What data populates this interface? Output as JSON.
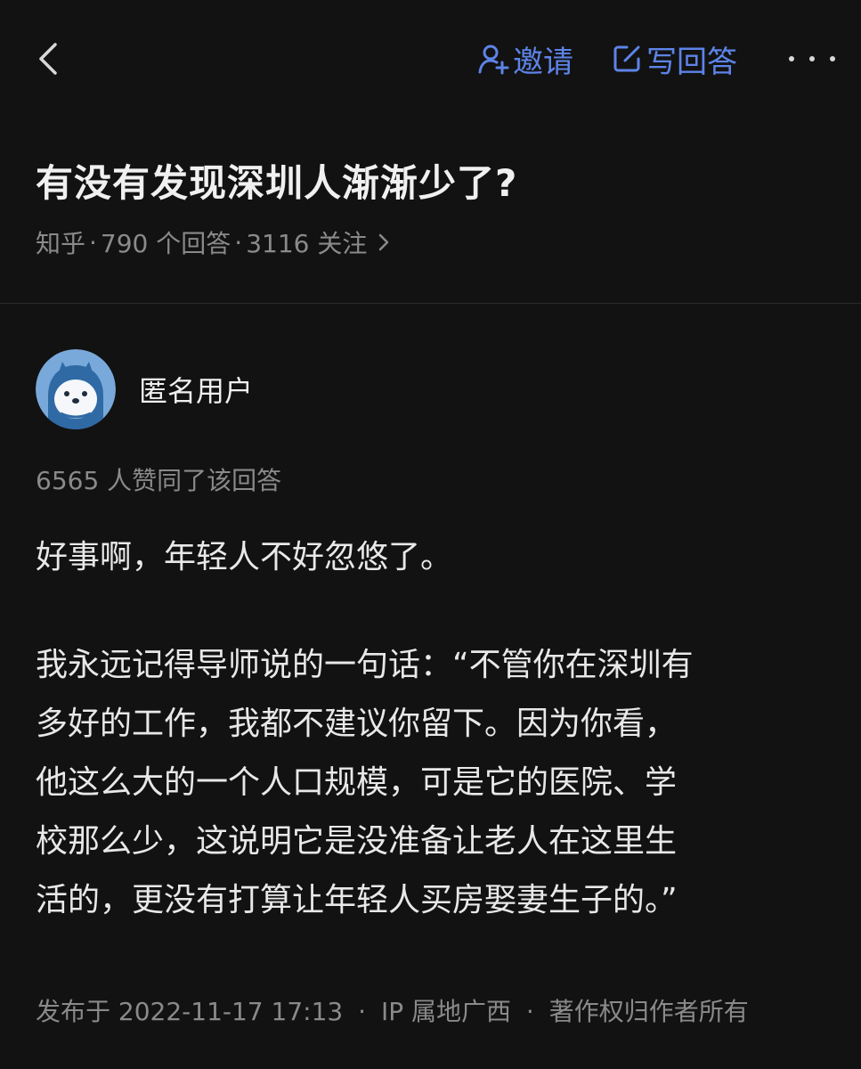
{
  "header": {
    "back_icon": "chevron-left-icon",
    "invite_label": "邀请",
    "invite_icon": "person-add-icon",
    "write_label": "写回答",
    "write_icon": "edit-icon",
    "more_icon": "more-horizontal-icon",
    "accent_color": "#5d84e8"
  },
  "question": {
    "title": "有没有发现深圳人渐渐少了?",
    "source": "知乎",
    "answers": "790 个回答",
    "follows": "3116 关注",
    "dot": "·"
  },
  "answer": {
    "author": "匿名用户",
    "avatar_icon": "anonymous-avatar-icon",
    "votes": "6565 人赞同了该回答",
    "paragraph1": "好事啊，年轻人不好忽悠了。",
    "paragraph2_lines": [
      "我永远记得导师说的一句话：“不管你在深圳有",
      "多好的工作，我都不建议你留下。因为你看，",
      "他这么大的一个人口规模，可是它的医院、学",
      "校那么少，这说明它是没准备让老人在这里生",
      "活的，更没有打算让年轻人买房娶妻生子的。”"
    ],
    "published": "发布于 2022-11-17 17:13",
    "ip": "IP 属地广西",
    "copyright": "著作权归作者所有",
    "sep": "·"
  },
  "theme": {
    "background": "#121212",
    "text": "#ebebeb",
    "muted": "#8a8a8a"
  }
}
